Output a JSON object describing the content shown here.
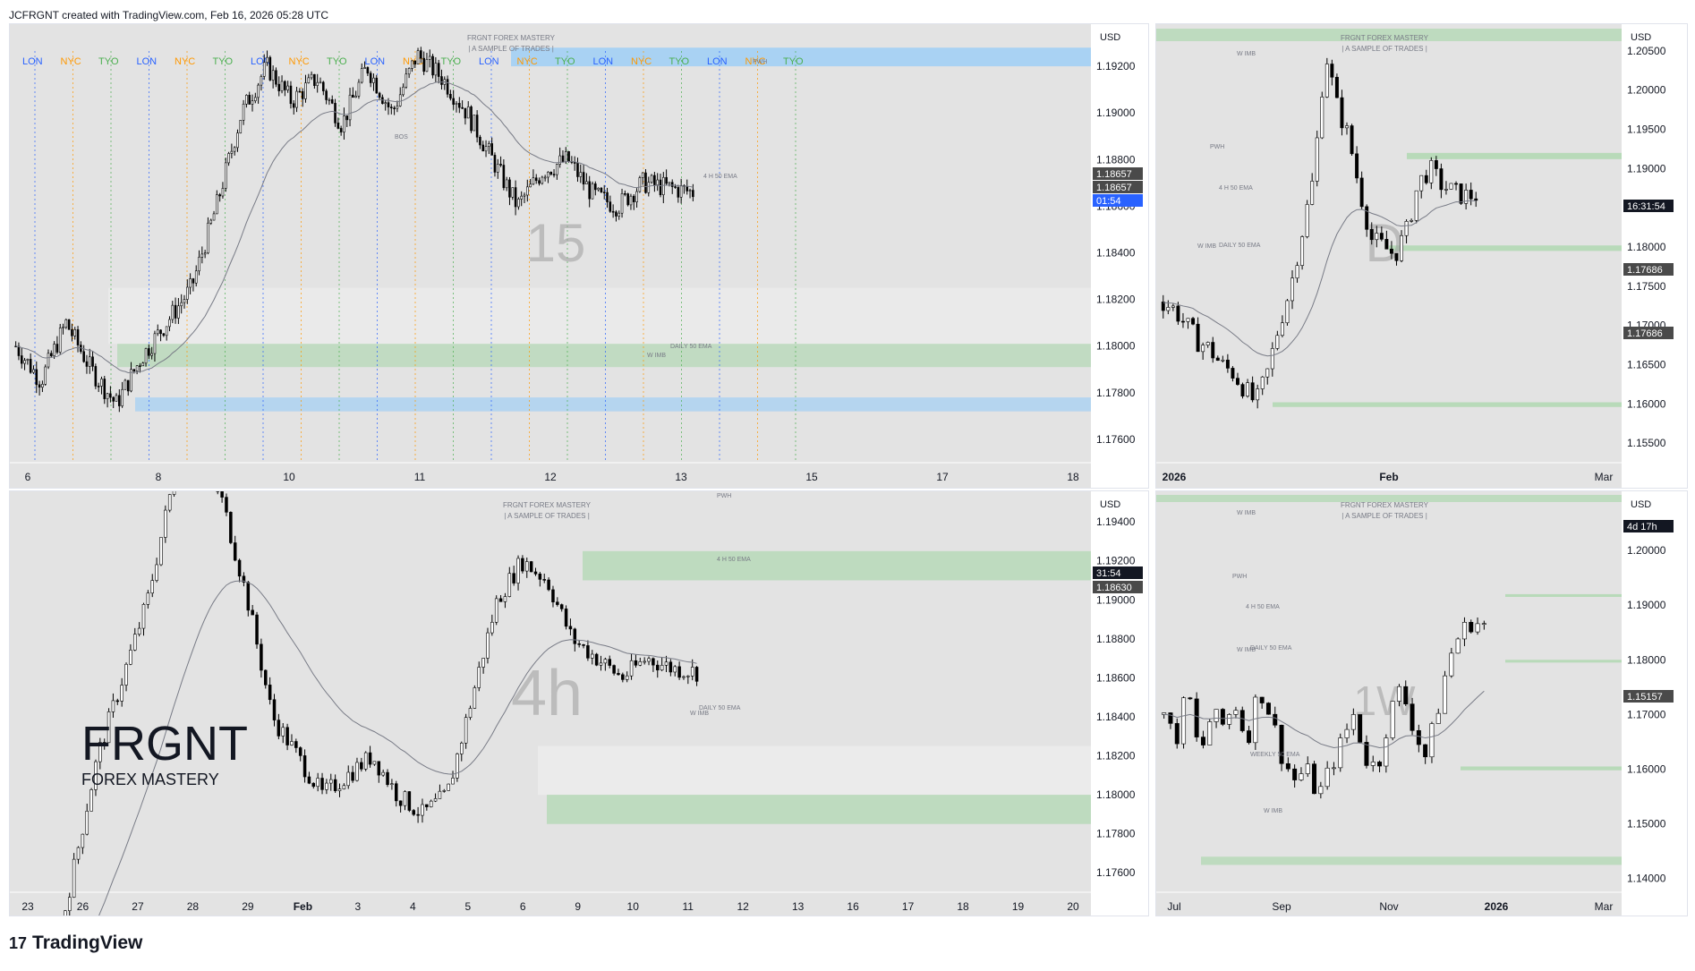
{
  "header": {
    "attribution": "JCFRGNT created with TradingView.com, Feb 16, 2026 05:28 UTC"
  },
  "footer": {
    "brand": "TradingView",
    "logo_icon": "tradingview-logo-icon"
  },
  "watermark": {
    "title": "FRGNT FOREX MASTERY",
    "subtitle": "| A SAMPLE OF TRADES |",
    "brand_big": "FRGNT",
    "brand_small": "FOREX MASTERY"
  },
  "colors": {
    "background": "#e3e3e3",
    "candle_up": "#ffffff",
    "candle_down": "#000000",
    "blue_zone": "#2962ff",
    "green_zone": "#4caf50",
    "ema": "#787b86"
  },
  "chart_data": [
    {
      "id": "p15",
      "type": "candlestick",
      "timeframe_label": "15",
      "currency": "USD",
      "x_ticks": [
        "6",
        "8",
        "10",
        "11",
        "12",
        "13",
        "15",
        "17",
        "18"
      ],
      "y_ticks": [
        "1.19200",
        "1.19000",
        "1.18800",
        "1.18600",
        "1.18400",
        "1.18200",
        "1.18000",
        "1.17800",
        "1.17600"
      ],
      "ylim": [
        1.175,
        1.1935
      ],
      "session_labels": [
        "LON",
        "NYC",
        "TYO",
        "LON",
        "NYC",
        "TYO",
        "LON",
        "NYC",
        "TYO",
        "LON",
        "NYC",
        "TYO",
        "LON",
        "NYC",
        "TYO",
        "LON",
        "NYC",
        "TYO",
        "LON",
        "NYC",
        "TYO"
      ],
      "price_labels": [
        {
          "text": "1.18657",
          "color": "#4a4a4a"
        },
        {
          "text": "1.18657",
          "color": "#4a4a4a"
        },
        {
          "text": "01:54",
          "color": "#2962ff"
        }
      ],
      "annotations": [
        "PWH",
        "BOS",
        "4 H 50 EMA",
        "DAILY 50 EMA",
        "W IMB"
      ],
      "levels": {
        "pwh": 1.1928,
        "bos": 1.1885,
        "ema4h": 1.186,
        "zone_low": 1.1801,
        "daily_ema": 1.1775,
        "wimb": 1.177,
        "last": 1.18657
      },
      "path": [
        1.18,
        1.1785,
        1.181,
        1.179,
        1.1775,
        1.1795,
        1.181,
        1.1825,
        1.186,
        1.19,
        1.192,
        1.1905,
        1.1915,
        1.1895,
        1.192,
        1.19,
        1.1925,
        1.1915,
        1.19,
        1.188,
        1.186,
        1.1875,
        1.188,
        1.1865,
        1.186,
        1.187,
        1.1868,
        1.1866
      ]
    },
    {
      "id": "pD",
      "type": "candlestick",
      "timeframe_label": "D",
      "currency": "USD",
      "x_ticks": [
        "2026",
        "Feb",
        "Mar"
      ],
      "y_ticks": [
        "1.20500",
        "1.20000",
        "1.19500",
        "1.19000",
        "1.18500",
        "1.18000",
        "1.17500",
        "1.17000",
        "1.16500",
        "1.16000",
        "1.15500"
      ],
      "ylim": [
        1.1525,
        1.2075
      ],
      "price_labels": [
        {
          "text": "16:31:54",
          "color": "#131722"
        },
        {
          "text": "1.17686",
          "color": "#4a4a4a"
        },
        {
          "text": "1.17686",
          "color": "#4a4a4a"
        }
      ],
      "annotations": [
        "W IMB",
        "PWH",
        "4 H 50 EMA",
        "DAILY 50 EMA",
        "W IMB"
      ],
      "path": [
        1.173,
        1.172,
        1.17,
        1.168,
        1.167,
        1.165,
        1.164,
        1.162,
        1.16,
        1.164,
        1.17,
        1.175,
        1.182,
        1.189,
        1.205,
        1.198,
        1.194,
        1.187,
        1.181,
        1.18,
        1.179,
        1.182,
        1.188,
        1.19,
        1.188,
        1.187,
        1.1865,
        1.1866
      ]
    },
    {
      "id": "p4h",
      "type": "candlestick",
      "timeframe_label": "4h",
      "currency": "USD",
      "x_ticks": [
        "23",
        "26",
        "27",
        "28",
        "29",
        "Feb",
        "3",
        "4",
        "5",
        "6",
        "9",
        "10",
        "11",
        "12",
        "13",
        "16",
        "17",
        "18",
        "19",
        "20"
      ],
      "y_ticks": [
        "1.19400",
        "1.19200",
        "1.19000",
        "1.18800",
        "1.18600",
        "1.18400",
        "1.18200",
        "1.18000",
        "1.17800",
        "1.17600"
      ],
      "ylim": [
        1.175,
        1.1952
      ],
      "price_labels": [
        {
          "text": "31:54",
          "color": "#131722"
        },
        {
          "text": "1.18630",
          "color": "#4a4a4a"
        }
      ],
      "annotations": [
        "PWH",
        "4 H 50 EMA",
        "DAILY 50 EMA",
        "W IMB"
      ],
      "path": [
        1.17,
        1.176,
        1.182,
        1.186,
        1.19,
        1.196,
        1.198,
        1.195,
        1.19,
        1.184,
        1.182,
        1.18,
        1.181,
        1.182,
        1.18,
        1.179,
        1.18,
        1.185,
        1.19,
        1.192,
        1.191,
        1.188,
        1.187,
        1.186,
        1.187,
        1.1865,
        1.1863
      ]
    },
    {
      "id": "pW",
      "type": "candlestick",
      "timeframe_label": "1W",
      "currency": "USD",
      "x_ticks": [
        "Jul",
        "Sep",
        "Nov",
        "2026",
        "Mar"
      ],
      "y_ticks": [
        "1.20000",
        "1.19000",
        "1.18000",
        "1.17000",
        "1.16000",
        "1.15000",
        "1.14000"
      ],
      "ylim": [
        1.1375,
        1.2095
      ],
      "price_labels": [
        {
          "text": "4d 17h",
          "color": "#131722"
        },
        {
          "text": "1.15157",
          "color": "#4a4a4a"
        }
      ],
      "annotations": [
        "W IMB",
        "PWH",
        "4 H 50 EMA",
        "W IMB",
        "DAILY 50 EMA",
        "WEEKLY 50 EMA",
        "W IMB"
      ],
      "path": [
        1.17,
        1.165,
        1.175,
        1.162,
        1.17,
        1.168,
        1.172,
        1.165,
        1.175,
        1.17,
        1.162,
        1.158,
        1.16,
        1.155,
        1.16,
        1.165,
        1.17,
        1.162,
        1.16,
        1.17,
        1.175,
        1.168,
        1.162,
        1.17,
        1.18,
        1.185,
        1.187,
        1.1863
      ]
    }
  ]
}
